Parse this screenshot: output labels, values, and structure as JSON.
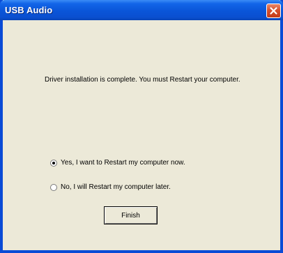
{
  "window": {
    "title": "USB Audio"
  },
  "dialog": {
    "message": "Driver installation is complete. You must Restart your computer.",
    "options": [
      {
        "label": "Yes, I want to Restart my computer now.",
        "selected": true
      },
      {
        "label": "No, I will Restart my computer later.",
        "selected": false
      }
    ],
    "finish_label": "Finish"
  },
  "colors": {
    "titlebar": "#0a55d8",
    "frame": "#0a4bd6",
    "client_bg": "#ece9d8",
    "close_button": "#d6512d"
  },
  "icons": {
    "close": "close-icon"
  }
}
